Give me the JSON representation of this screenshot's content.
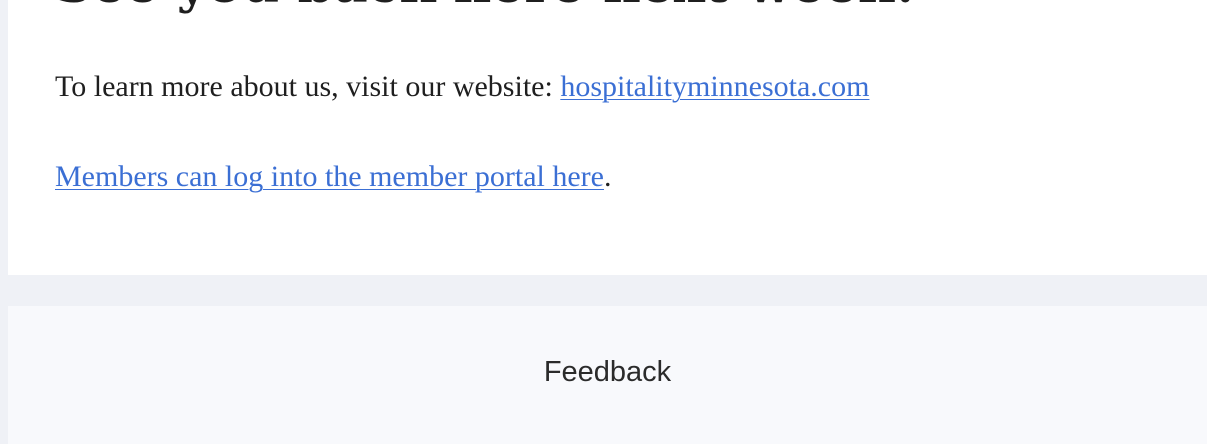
{
  "email": {
    "heading": "See you back here next week!",
    "website_prefix": "To learn more about us, visit our website: ",
    "website_link": "hospitalityminnesota.com",
    "member_portal_link": "Members can log into the member portal here",
    "member_portal_suffix": "."
  },
  "footer": {
    "feedback_label": "Feedback"
  },
  "colors": {
    "link": "#3b6fd4",
    "page_background": "#eff1f6",
    "card_background": "#ffffff",
    "footer_background": "#f8f9fc"
  }
}
